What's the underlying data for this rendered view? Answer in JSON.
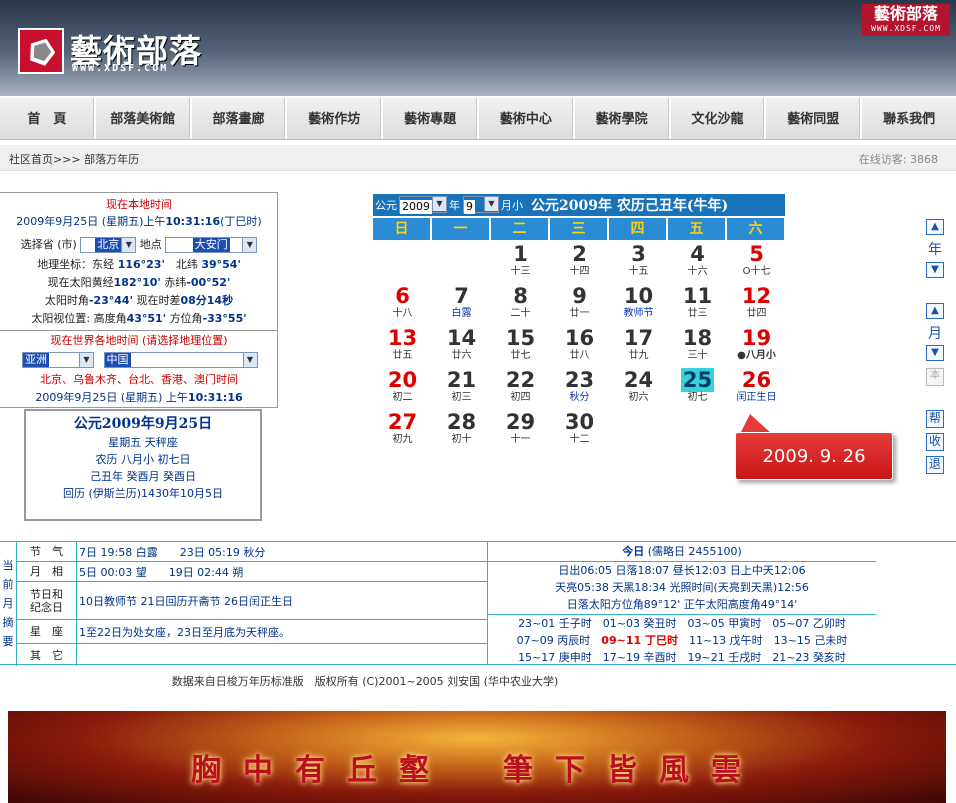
{
  "header": {
    "logo_text": "藝術部落",
    "logo_url": "WWW.XDSF.COM",
    "badge_title": "藝術部落",
    "badge_url": "WWW.XDSF.COM"
  },
  "nav": [
    "首　頁",
    "部落美術館",
    "部落畫廊",
    "藝術作坊",
    "藝術專題",
    "藝術中心",
    "藝術學院",
    "文化沙龍",
    "藝術同盟",
    "聯系我們"
  ],
  "breadcrumb": "社区首页>>>  部落万年历",
  "visitors": "在线访客:  3868",
  "local": {
    "heading": "现在本地时间",
    "datetime_prefix": "2009年9月25日  (星期五)上午",
    "time": "10:31:16",
    "shichen": "(丁巳时)",
    "province_label": "选择省 (市)",
    "province_value": "北京",
    "place_label": "地点",
    "place_value": "大安门",
    "coord_label": "地理坐标：东经",
    "lon": "116°23'",
    "lat_label": "北纬",
    "lat": "39°54'",
    "ecl_label": "现在太阳黄经",
    "ecl": "182°10'",
    "dec_label": "赤纬",
    "dec": "-00°52'",
    "sunhour_label": "太阳时角",
    "sunhour": "-23°44'",
    "timediff_label": "现在时差",
    "timediff": "08分14秒",
    "sunpos_label": "太阳视位置: 高度角",
    "alt": "43°51'",
    "azi_label": "方位角",
    "azi": "-33°55'"
  },
  "world": {
    "heading": "现在世界各地时间 (请选择地理位置)",
    "region_value": "亚洲",
    "country_value": "中国",
    "cities": "北京、乌鲁木齐、台北、香港、澳门时间",
    "datetime_prefix": "2009年9月25日  (星期五) 上午",
    "time": "10:31:16"
  },
  "datebox": {
    "title": "公元2009年9月25日",
    "week": "星期五  天秤座",
    "lunar": "农历  八月小  初七日",
    "ganzhi": "己丑年  癸酉月  癸酉日",
    "islamic": "回历 (伊斯兰历)1430年10月5日"
  },
  "calendar": {
    "era_label": "公元",
    "year": "2009",
    "year_label": "年",
    "month": "9",
    "month_label": "月小",
    "title": "公元2009年  农历己丑年(牛年)",
    "weekdays": [
      "日",
      "一",
      "二",
      "三",
      "四",
      "五",
      "六"
    ],
    "days": [
      {
        "d": "1",
        "l": "十三",
        "col": 2,
        "row": 0
      },
      {
        "d": "2",
        "l": "十四",
        "col": 3,
        "row": 0
      },
      {
        "d": "3",
        "l": "十五",
        "col": 4,
        "row": 0
      },
      {
        "d": "4",
        "l": "十六",
        "col": 5,
        "row": 0
      },
      {
        "d": "5",
        "l": "O十七",
        "col": 6,
        "row": 0,
        "red": true
      },
      {
        "d": "6",
        "l": "十八",
        "col": 0,
        "row": 1,
        "red": true
      },
      {
        "d": "7",
        "l": "白露",
        "col": 1,
        "row": 1,
        "blue": true
      },
      {
        "d": "8",
        "l": "二十",
        "col": 2,
        "row": 1
      },
      {
        "d": "9",
        "l": "廿一",
        "col": 3,
        "row": 1
      },
      {
        "d": "10",
        "l": "教师节",
        "col": 4,
        "row": 1,
        "blue": true
      },
      {
        "d": "11",
        "l": "廿三",
        "col": 5,
        "row": 1
      },
      {
        "d": "12",
        "l": "廿四",
        "col": 6,
        "row": 1,
        "red": true
      },
      {
        "d": "13",
        "l": "廿五",
        "col": 0,
        "row": 2,
        "red": true
      },
      {
        "d": "14",
        "l": "廿六",
        "col": 1,
        "row": 2
      },
      {
        "d": "15",
        "l": "廿七",
        "col": 2,
        "row": 2
      },
      {
        "d": "16",
        "l": "廿八",
        "col": 3,
        "row": 2
      },
      {
        "d": "17",
        "l": "廿九",
        "col": 4,
        "row": 2
      },
      {
        "d": "18",
        "l": "三十",
        "col": 5,
        "row": 2
      },
      {
        "d": "19",
        "l": "●八月小",
        "col": 6,
        "row": 2,
        "red": true,
        "bold": true
      },
      {
        "d": "20",
        "l": "初二",
        "col": 0,
        "row": 3,
        "red": true
      },
      {
        "d": "21",
        "l": "初三",
        "col": 1,
        "row": 3
      },
      {
        "d": "22",
        "l": "初四",
        "col": 2,
        "row": 3
      },
      {
        "d": "23",
        "l": "秋分",
        "col": 3,
        "row": 3,
        "blue": true
      },
      {
        "d": "24",
        "l": "初六",
        "col": 4,
        "row": 3
      },
      {
        "d": "25",
        "l": "初七",
        "col": 5,
        "row": 3,
        "today": true
      },
      {
        "d": "26",
        "l": "闰正生日",
        "col": 6,
        "row": 3,
        "red": true,
        "blue": true
      },
      {
        "d": "27",
        "l": "初九",
        "col": 0,
        "row": 4,
        "red": true
      },
      {
        "d": "28",
        "l": "初十",
        "col": 1,
        "row": 4
      },
      {
        "d": "29",
        "l": "十一",
        "col": 2,
        "row": 4
      },
      {
        "d": "30",
        "l": "十二",
        "col": 3,
        "row": 4
      }
    ]
  },
  "callout": "2009. 9. 26",
  "side": {
    "year_label": "年",
    "month_label": "月",
    "ben": "本",
    "help": "帮",
    "collect": "收",
    "back": "退",
    "up": "▲",
    "down": "▼"
  },
  "summary": {
    "title_chars": "当前月摘要",
    "rows": [
      {
        "label": "节　气",
        "value": "7日 19:58 白露　　23日 05:19 秋分"
      },
      {
        "label": "月　相",
        "value": "5日 00:03 望　　19日 02:44 朔"
      },
      {
        "label": "节日和纪念日",
        "value": "10日教师节 21日回历开斋节 26日闰正生日"
      },
      {
        "label": "星　座",
        "value": "1至22日为处女座，23日至月底为天秤座。"
      },
      {
        "label": "其　它",
        "value": ""
      }
    ]
  },
  "today": {
    "title": "今日",
    "julian": "(儒略日 2455100)",
    "sun": "日出06:05 日落18:07  昼长12:03  日上中天12:06",
    "twilight": "天亮05:38 天黑18:34  光照时间(天亮到天黑)12:56",
    "sunpos": "日落太阳方位角89°12'  正午太阳高度角49°14'",
    "hours": [
      [
        "23~01 壬子时",
        "01~03 癸丑时",
        "03~05 甲寅时",
        "05~07 乙卯时"
      ],
      [
        "07~09 丙辰时",
        "09~11 丁巳时",
        "11~13 戊午时",
        "13~15 己未时"
      ],
      [
        "15~17 庚申时",
        "17~19 辛酉时",
        "19~21 壬戌时",
        "21~23 癸亥时"
      ]
    ]
  },
  "copyright": "数据来自日梭万年历标准版　版权所有 (C)2001~2005  刘安国 (华中农业大学)",
  "banner": "胸中有丘壑　筆下皆風雲"
}
